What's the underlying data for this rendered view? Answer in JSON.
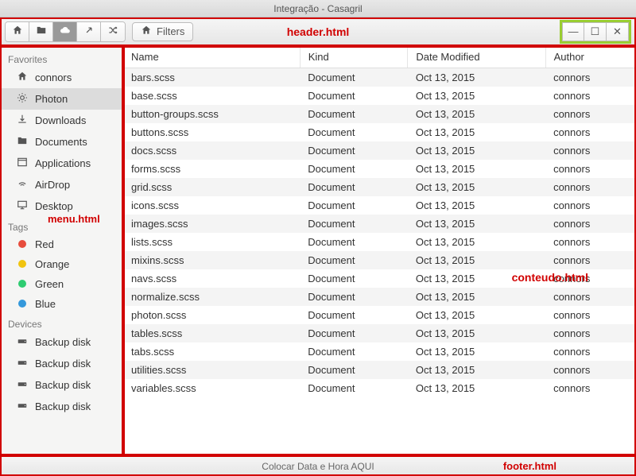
{
  "window": {
    "title": "Integração - Casagril"
  },
  "header": {
    "filters_label": "Filters",
    "annotation": "header.html"
  },
  "sidebar": {
    "annotation": "menu.html",
    "sections": [
      {
        "title": "Favorites",
        "items": [
          {
            "icon": "home",
            "label": "connors"
          },
          {
            "icon": "light",
            "label": "Photon",
            "active": true
          },
          {
            "icon": "download",
            "label": "Downloads"
          },
          {
            "icon": "folder",
            "label": "Documents"
          },
          {
            "icon": "window",
            "label": "Applications"
          },
          {
            "icon": "signal",
            "label": "AirDrop"
          },
          {
            "icon": "monitor",
            "label": "Desktop"
          }
        ]
      },
      {
        "title": "Tags",
        "items": [
          {
            "icon": "dot",
            "color": "#e74c3c",
            "label": "Red"
          },
          {
            "icon": "dot",
            "color": "#f1c40f",
            "label": "Orange"
          },
          {
            "icon": "dot",
            "color": "#2ecc71",
            "label": "Green"
          },
          {
            "icon": "dot",
            "color": "#3498db",
            "label": "Blue"
          }
        ]
      },
      {
        "title": "Devices",
        "items": [
          {
            "icon": "drive",
            "label": "Backup disk"
          },
          {
            "icon": "drive",
            "label": "Backup disk"
          },
          {
            "icon": "drive",
            "label": "Backup disk"
          },
          {
            "icon": "drive",
            "label": "Backup disk"
          }
        ]
      }
    ]
  },
  "content": {
    "annotation": "conteudo.html",
    "columns": [
      "Name",
      "Kind",
      "Date Modified",
      "Author"
    ],
    "rows": [
      {
        "name": "bars.scss",
        "kind": "Document",
        "date": "Oct 13, 2015",
        "author": "connors"
      },
      {
        "name": "base.scss",
        "kind": "Document",
        "date": "Oct 13, 2015",
        "author": "connors"
      },
      {
        "name": "button-groups.scss",
        "kind": "Document",
        "date": "Oct 13, 2015",
        "author": "connors"
      },
      {
        "name": "buttons.scss",
        "kind": "Document",
        "date": "Oct 13, 2015",
        "author": "connors"
      },
      {
        "name": "docs.scss",
        "kind": "Document",
        "date": "Oct 13, 2015",
        "author": "connors"
      },
      {
        "name": "forms.scss",
        "kind": "Document",
        "date": "Oct 13, 2015",
        "author": "connors"
      },
      {
        "name": "grid.scss",
        "kind": "Document",
        "date": "Oct 13, 2015",
        "author": "connors"
      },
      {
        "name": "icons.scss",
        "kind": "Document",
        "date": "Oct 13, 2015",
        "author": "connors"
      },
      {
        "name": "images.scss",
        "kind": "Document",
        "date": "Oct 13, 2015",
        "author": "connors"
      },
      {
        "name": "lists.scss",
        "kind": "Document",
        "date": "Oct 13, 2015",
        "author": "connors"
      },
      {
        "name": "mixins.scss",
        "kind": "Document",
        "date": "Oct 13, 2015",
        "author": "connors"
      },
      {
        "name": "navs.scss",
        "kind": "Document",
        "date": "Oct 13, 2015",
        "author": "connors"
      },
      {
        "name": "normalize.scss",
        "kind": "Document",
        "date": "Oct 13, 2015",
        "author": "connors"
      },
      {
        "name": "photon.scss",
        "kind": "Document",
        "date": "Oct 13, 2015",
        "author": "connors"
      },
      {
        "name": "tables.scss",
        "kind": "Document",
        "date": "Oct 13, 2015",
        "author": "connors"
      },
      {
        "name": "tabs.scss",
        "kind": "Document",
        "date": "Oct 13, 2015",
        "author": "connors"
      },
      {
        "name": "utilities.scss",
        "kind": "Document",
        "date": "Oct 13, 2015",
        "author": "connors"
      },
      {
        "name": "variables.scss",
        "kind": "Document",
        "date": "Oct 13, 2015",
        "author": "connors"
      }
    ]
  },
  "footer": {
    "text": "Colocar Data e Hora AQUI",
    "annotation": "footer.html"
  }
}
